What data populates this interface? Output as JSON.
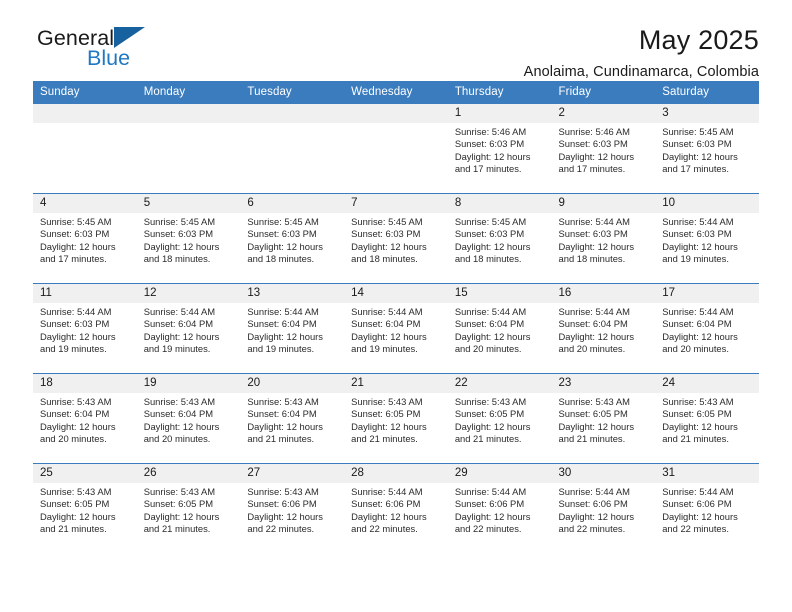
{
  "brand": {
    "word_one": "General",
    "word_two": "Blue",
    "flag_icon": "triangle-flag-icon",
    "primary_color": "#17619e",
    "accent_color": "#1f78c1"
  },
  "header": {
    "month_title": "May 2025",
    "location": "Anolaima, Cundinamarca, Colombia",
    "header_bg_color": "#3a7cbe"
  },
  "calendar": {
    "weekday_headers": [
      "Sunday",
      "Monday",
      "Tuesday",
      "Wednesday",
      "Thursday",
      "Friday",
      "Saturday"
    ],
    "weeks": [
      [
        {
          "day": "",
          "empty": true
        },
        {
          "day": "",
          "empty": true
        },
        {
          "day": "",
          "empty": true
        },
        {
          "day": "",
          "empty": true
        },
        {
          "day": "1",
          "sunrise": "Sunrise: 5:46 AM",
          "sunset": "Sunset: 6:03 PM",
          "daylight": "Daylight: 12 hours and 17 minutes."
        },
        {
          "day": "2",
          "sunrise": "Sunrise: 5:46 AM",
          "sunset": "Sunset: 6:03 PM",
          "daylight": "Daylight: 12 hours and 17 minutes."
        },
        {
          "day": "3",
          "sunrise": "Sunrise: 5:45 AM",
          "sunset": "Sunset: 6:03 PM",
          "daylight": "Daylight: 12 hours and 17 minutes."
        }
      ],
      [
        {
          "day": "4",
          "sunrise": "Sunrise: 5:45 AM",
          "sunset": "Sunset: 6:03 PM",
          "daylight": "Daylight: 12 hours and 17 minutes."
        },
        {
          "day": "5",
          "sunrise": "Sunrise: 5:45 AM",
          "sunset": "Sunset: 6:03 PM",
          "daylight": "Daylight: 12 hours and 18 minutes."
        },
        {
          "day": "6",
          "sunrise": "Sunrise: 5:45 AM",
          "sunset": "Sunset: 6:03 PM",
          "daylight": "Daylight: 12 hours and 18 minutes."
        },
        {
          "day": "7",
          "sunrise": "Sunrise: 5:45 AM",
          "sunset": "Sunset: 6:03 PM",
          "daylight": "Daylight: 12 hours and 18 minutes."
        },
        {
          "day": "8",
          "sunrise": "Sunrise: 5:45 AM",
          "sunset": "Sunset: 6:03 PM",
          "daylight": "Daylight: 12 hours and 18 minutes."
        },
        {
          "day": "9",
          "sunrise": "Sunrise: 5:44 AM",
          "sunset": "Sunset: 6:03 PM",
          "daylight": "Daylight: 12 hours and 18 minutes."
        },
        {
          "day": "10",
          "sunrise": "Sunrise: 5:44 AM",
          "sunset": "Sunset: 6:03 PM",
          "daylight": "Daylight: 12 hours and 19 minutes."
        }
      ],
      [
        {
          "day": "11",
          "sunrise": "Sunrise: 5:44 AM",
          "sunset": "Sunset: 6:03 PM",
          "daylight": "Daylight: 12 hours and 19 minutes."
        },
        {
          "day": "12",
          "sunrise": "Sunrise: 5:44 AM",
          "sunset": "Sunset: 6:04 PM",
          "daylight": "Daylight: 12 hours and 19 minutes."
        },
        {
          "day": "13",
          "sunrise": "Sunrise: 5:44 AM",
          "sunset": "Sunset: 6:04 PM",
          "daylight": "Daylight: 12 hours and 19 minutes."
        },
        {
          "day": "14",
          "sunrise": "Sunrise: 5:44 AM",
          "sunset": "Sunset: 6:04 PM",
          "daylight": "Daylight: 12 hours and 19 minutes."
        },
        {
          "day": "15",
          "sunrise": "Sunrise: 5:44 AM",
          "sunset": "Sunset: 6:04 PM",
          "daylight": "Daylight: 12 hours and 20 minutes."
        },
        {
          "day": "16",
          "sunrise": "Sunrise: 5:44 AM",
          "sunset": "Sunset: 6:04 PM",
          "daylight": "Daylight: 12 hours and 20 minutes."
        },
        {
          "day": "17",
          "sunrise": "Sunrise: 5:44 AM",
          "sunset": "Sunset: 6:04 PM",
          "daylight": "Daylight: 12 hours and 20 minutes."
        }
      ],
      [
        {
          "day": "18",
          "sunrise": "Sunrise: 5:43 AM",
          "sunset": "Sunset: 6:04 PM",
          "daylight": "Daylight: 12 hours and 20 minutes."
        },
        {
          "day": "19",
          "sunrise": "Sunrise: 5:43 AM",
          "sunset": "Sunset: 6:04 PM",
          "daylight": "Daylight: 12 hours and 20 minutes."
        },
        {
          "day": "20",
          "sunrise": "Sunrise: 5:43 AM",
          "sunset": "Sunset: 6:04 PM",
          "daylight": "Daylight: 12 hours and 21 minutes."
        },
        {
          "day": "21",
          "sunrise": "Sunrise: 5:43 AM",
          "sunset": "Sunset: 6:05 PM",
          "daylight": "Daylight: 12 hours and 21 minutes."
        },
        {
          "day": "22",
          "sunrise": "Sunrise: 5:43 AM",
          "sunset": "Sunset: 6:05 PM",
          "daylight": "Daylight: 12 hours and 21 minutes."
        },
        {
          "day": "23",
          "sunrise": "Sunrise: 5:43 AM",
          "sunset": "Sunset: 6:05 PM",
          "daylight": "Daylight: 12 hours and 21 minutes."
        },
        {
          "day": "24",
          "sunrise": "Sunrise: 5:43 AM",
          "sunset": "Sunset: 6:05 PM",
          "daylight": "Daylight: 12 hours and 21 minutes."
        }
      ],
      [
        {
          "day": "25",
          "sunrise": "Sunrise: 5:43 AM",
          "sunset": "Sunset: 6:05 PM",
          "daylight": "Daylight: 12 hours and 21 minutes."
        },
        {
          "day": "26",
          "sunrise": "Sunrise: 5:43 AM",
          "sunset": "Sunset: 6:05 PM",
          "daylight": "Daylight: 12 hours and 21 minutes."
        },
        {
          "day": "27",
          "sunrise": "Sunrise: 5:43 AM",
          "sunset": "Sunset: 6:06 PM",
          "daylight": "Daylight: 12 hours and 22 minutes."
        },
        {
          "day": "28",
          "sunrise": "Sunrise: 5:44 AM",
          "sunset": "Sunset: 6:06 PM",
          "daylight": "Daylight: 12 hours and 22 minutes."
        },
        {
          "day": "29",
          "sunrise": "Sunrise: 5:44 AM",
          "sunset": "Sunset: 6:06 PM",
          "daylight": "Daylight: 12 hours and 22 minutes."
        },
        {
          "day": "30",
          "sunrise": "Sunrise: 5:44 AM",
          "sunset": "Sunset: 6:06 PM",
          "daylight": "Daylight: 12 hours and 22 minutes."
        },
        {
          "day": "31",
          "sunrise": "Sunrise: 5:44 AM",
          "sunset": "Sunset: 6:06 PM",
          "daylight": "Daylight: 12 hours and 22 minutes."
        }
      ]
    ]
  }
}
